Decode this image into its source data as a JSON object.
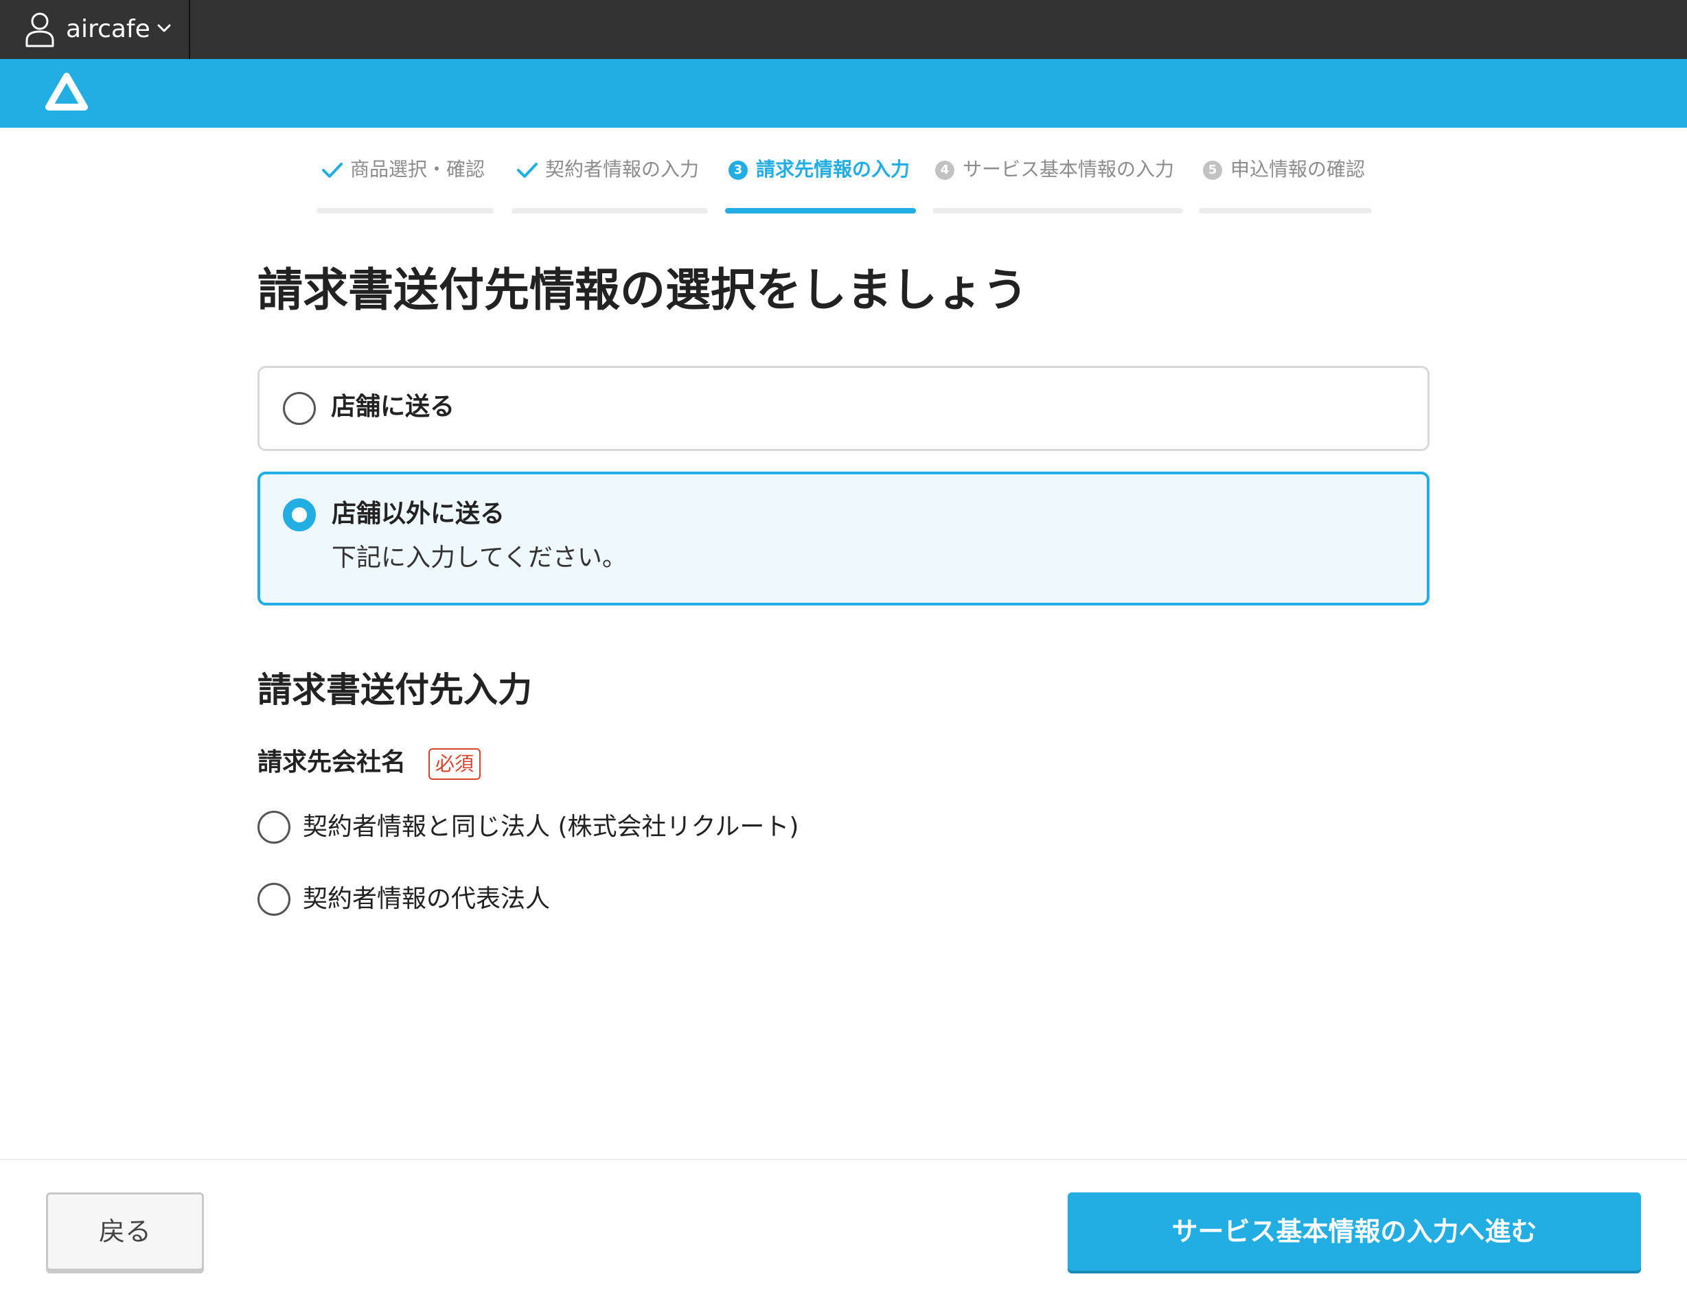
{
  "account": {
    "name": "aircafe",
    "user_icon": "user-icon",
    "chevron_icon": "chevron-down-icon"
  },
  "brand": {
    "logo_icon": "air-logo-icon",
    "color": "#22ade3"
  },
  "steps": [
    {
      "label": "商品選択・確認",
      "state": "done"
    },
    {
      "label": "契約者情報の入力",
      "state": "done"
    },
    {
      "number": "3",
      "label": "請求先情報の入力",
      "state": "current"
    },
    {
      "number": "4",
      "label": "サービス基本情報の入力",
      "state": "upcoming"
    },
    {
      "number": "5",
      "label": "申込情報の確認",
      "state": "upcoming"
    }
  ],
  "page_title": "請求書送付先情報の選択をしましょう",
  "send_options": [
    {
      "label": "店舗に送る",
      "selected": false
    },
    {
      "label": "店舗以外に送る",
      "description": "下記に入力してください。",
      "selected": true
    }
  ],
  "section_title": "請求書送付先入力",
  "company_field": {
    "label": "請求先会社名",
    "required_badge": "必須",
    "choices": [
      {
        "label": "契約者情報と同じ法人 (株式会社リクルート)",
        "selected": false
      },
      {
        "label": "契約者情報の代表法人",
        "selected": false
      }
    ]
  },
  "footer": {
    "back_label": "戻る",
    "next_label": "サービス基本情報の入力へ進む"
  },
  "colors": {
    "accent": "#22ade3",
    "topbar": "#333333",
    "required": "#d8432c",
    "selected_card_bg": "#eef8fd"
  }
}
